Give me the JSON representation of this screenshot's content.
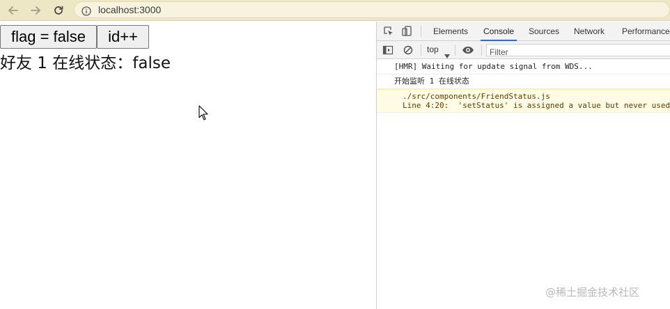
{
  "browser": {
    "url": "localhost:3000"
  },
  "page": {
    "buttons": {
      "flag_label": "flag = false",
      "id_label": "id++"
    },
    "status_text": "好友 1 在线状态：false"
  },
  "devtools": {
    "tabs": [
      {
        "label": "Elements"
      },
      {
        "label": "Console",
        "active": true
      },
      {
        "label": "Sources"
      },
      {
        "label": "Network"
      },
      {
        "label": "Performance"
      }
    ],
    "toolbar": {
      "context": "top",
      "filter_placeholder": "Filter"
    },
    "console": {
      "messages": [
        {
          "type": "log",
          "text": "[HMR] Waiting for update signal from WDS..."
        },
        {
          "type": "log",
          "text": "开始监听 1 在线状态"
        },
        {
          "type": "warning",
          "line1": "./src/components/FriendStatus.js",
          "line2": "Line 4:20:  'setStatus' is assigned a value but never used"
        }
      ]
    },
    "accent_color": "#1a73e8",
    "warning_bg": "#fffbe5"
  },
  "watermark": "@稀土掘金技术社区"
}
